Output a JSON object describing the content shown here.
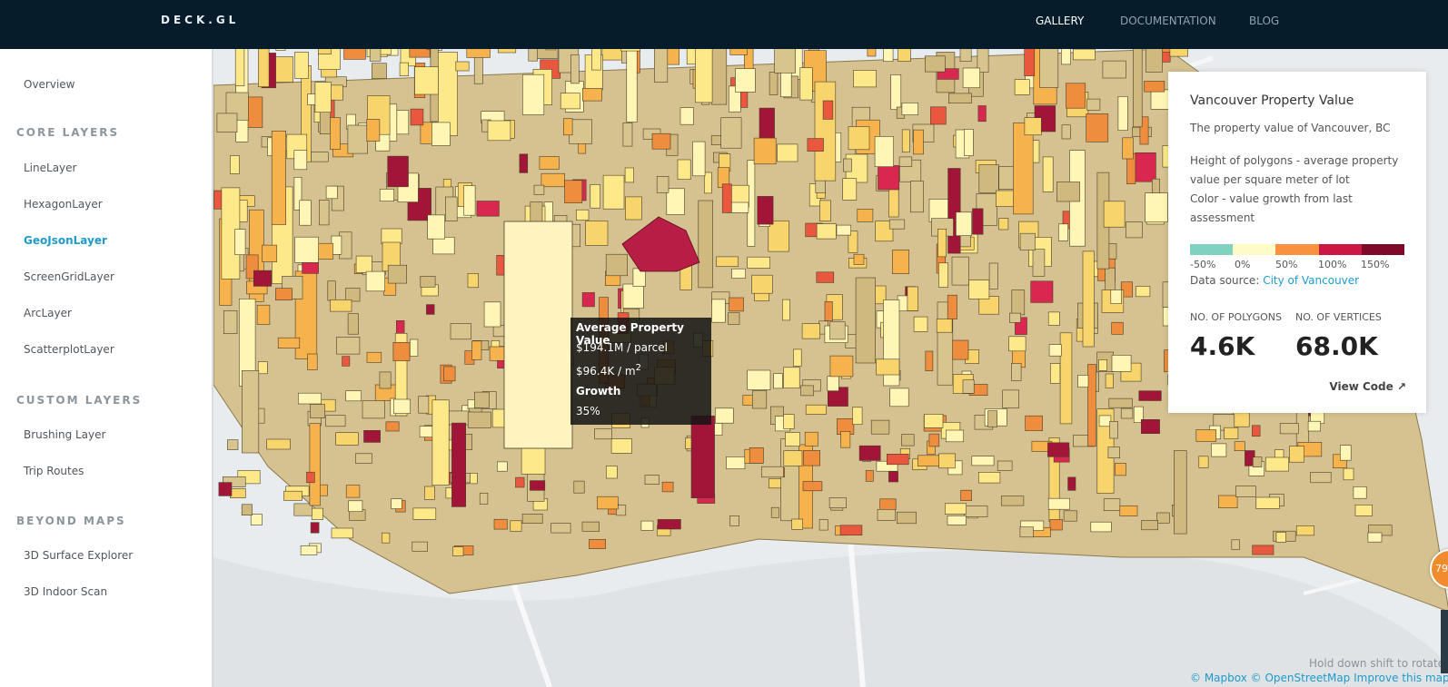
{
  "header": {
    "brand": "DECK.GL",
    "nav": [
      {
        "label": "GALLERY",
        "active": true
      },
      {
        "label": "DOCUMENTATION",
        "active": false
      },
      {
        "label": "BLOG",
        "active": false
      }
    ]
  },
  "sidebar": {
    "overview": "Overview",
    "sections": [
      {
        "heading": "CORE LAYERS",
        "items": [
          "LineLayer",
          "HexagonLayer",
          "GeoJsonLayer",
          "ScreenGridLayer",
          "ArcLayer",
          "ScatterplotLayer"
        ]
      },
      {
        "heading": "CUSTOM LAYERS",
        "items": [
          "Brushing Layer",
          "Trip Routes"
        ]
      },
      {
        "heading": "BEYOND MAPS",
        "items": [
          "3D Surface Explorer",
          "3D Indoor Scan"
        ]
      }
    ],
    "active_item": "GeoJsonLayer"
  },
  "tooltip": {
    "title": "Average Property Value",
    "per_parcel": "$194.1M / parcel",
    "per_m2": "$96.4K / m",
    "per_m2_sup": "2",
    "growth_label": "Growth",
    "growth_value": "35%"
  },
  "panel": {
    "title": "Vancouver Property Value",
    "subtitle": "The property value of Vancouver, BC",
    "desc_height": "Height of polygons - average property value per square meter of lot",
    "desc_color": "Color - value growth from last assessment",
    "scale_colors": [
      "#7fd1c0",
      "#fffbc8",
      "#f99240",
      "#cc1744",
      "#7e0a27"
    ],
    "scale_labels": [
      "-50%",
      "0%",
      "50%",
      "100%",
      "150%"
    ],
    "source_label": "Data source:",
    "source_link": "City of Vancouver",
    "polygons_label": "NO. OF POLYGONS",
    "polygons_value": "4.6K",
    "vertices_label": "NO. OF VERTICES",
    "vertices_value": "68.0K",
    "view_code": "View Code ↗"
  },
  "map": {
    "hint": "Hold down shift to rotate",
    "attribution": "© Mapbox © OpenStreetMap Improve this map",
    "fps": "79"
  }
}
